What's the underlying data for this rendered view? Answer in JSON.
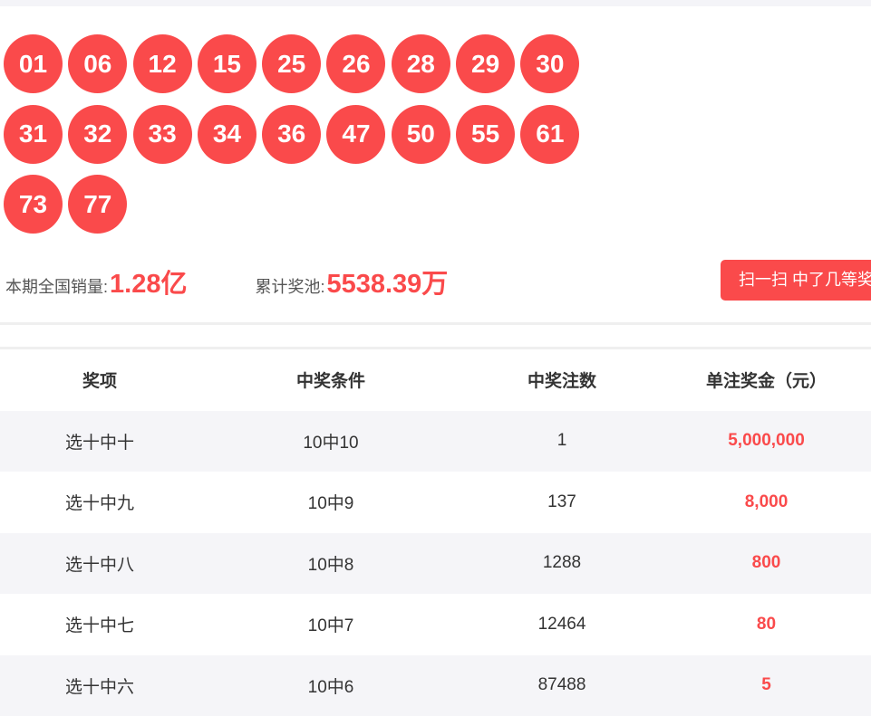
{
  "balls": [
    "01",
    "06",
    "12",
    "15",
    "25",
    "26",
    "28",
    "29",
    "30",
    "31",
    "32",
    "33",
    "34",
    "36",
    "47",
    "50",
    "55",
    "61",
    "73",
    "77"
  ],
  "stats": {
    "sales_label": "本期全国销量:",
    "sales_value": "1.28亿",
    "pool_label": "累计奖池:",
    "pool_value": "5538.39万"
  },
  "scan_button": "扫一扫 中了几等奖",
  "table": {
    "headers": [
      "奖项",
      "中奖条件",
      "中奖注数",
      "单注奖金（元）"
    ],
    "rows": [
      [
        "选十中十",
        "10中10",
        "1",
        "5,000,000"
      ],
      [
        "选十中九",
        "10中9",
        "137",
        "8,000"
      ],
      [
        "选十中八",
        "10中8",
        "1288",
        "800"
      ],
      [
        "选十中七",
        "10中7",
        "12464",
        "80"
      ],
      [
        "选十中六",
        "10中6",
        "87488",
        "5"
      ]
    ]
  },
  "colors": {
    "accent": "#fa4a4b"
  }
}
